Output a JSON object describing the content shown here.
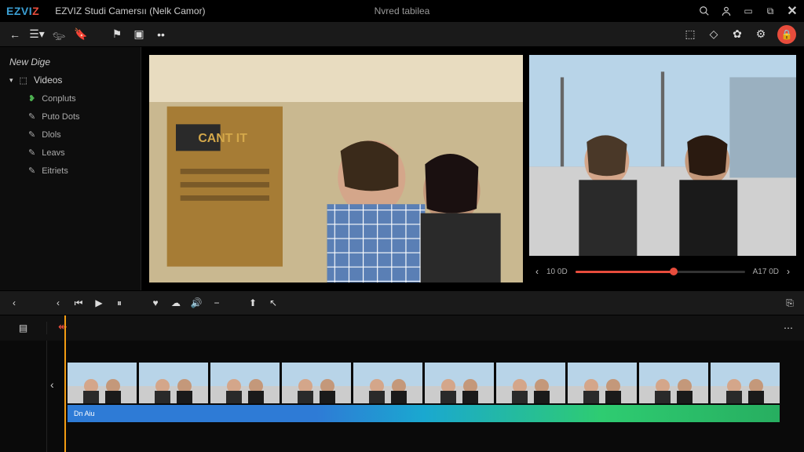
{
  "brand": {
    "part1": "EZVI",
    "part2": "Z"
  },
  "titlebar": {
    "title": "EZVIZ Studi Camersıı (Nelk Camor)",
    "center": "Nvred tabilea"
  },
  "sidebar": {
    "header": "New Dige",
    "root": "Videos",
    "items": [
      {
        "label": "Conpluts"
      },
      {
        "label": "Puto Dots"
      },
      {
        "label": "Dlols"
      },
      {
        "label": "Leavs"
      },
      {
        "label": "Eitriets"
      }
    ]
  },
  "preview": {
    "time_left": "10 0D",
    "time_right": "A17 0D"
  },
  "timeline": {
    "audio_label": "Dn Aiu"
  }
}
